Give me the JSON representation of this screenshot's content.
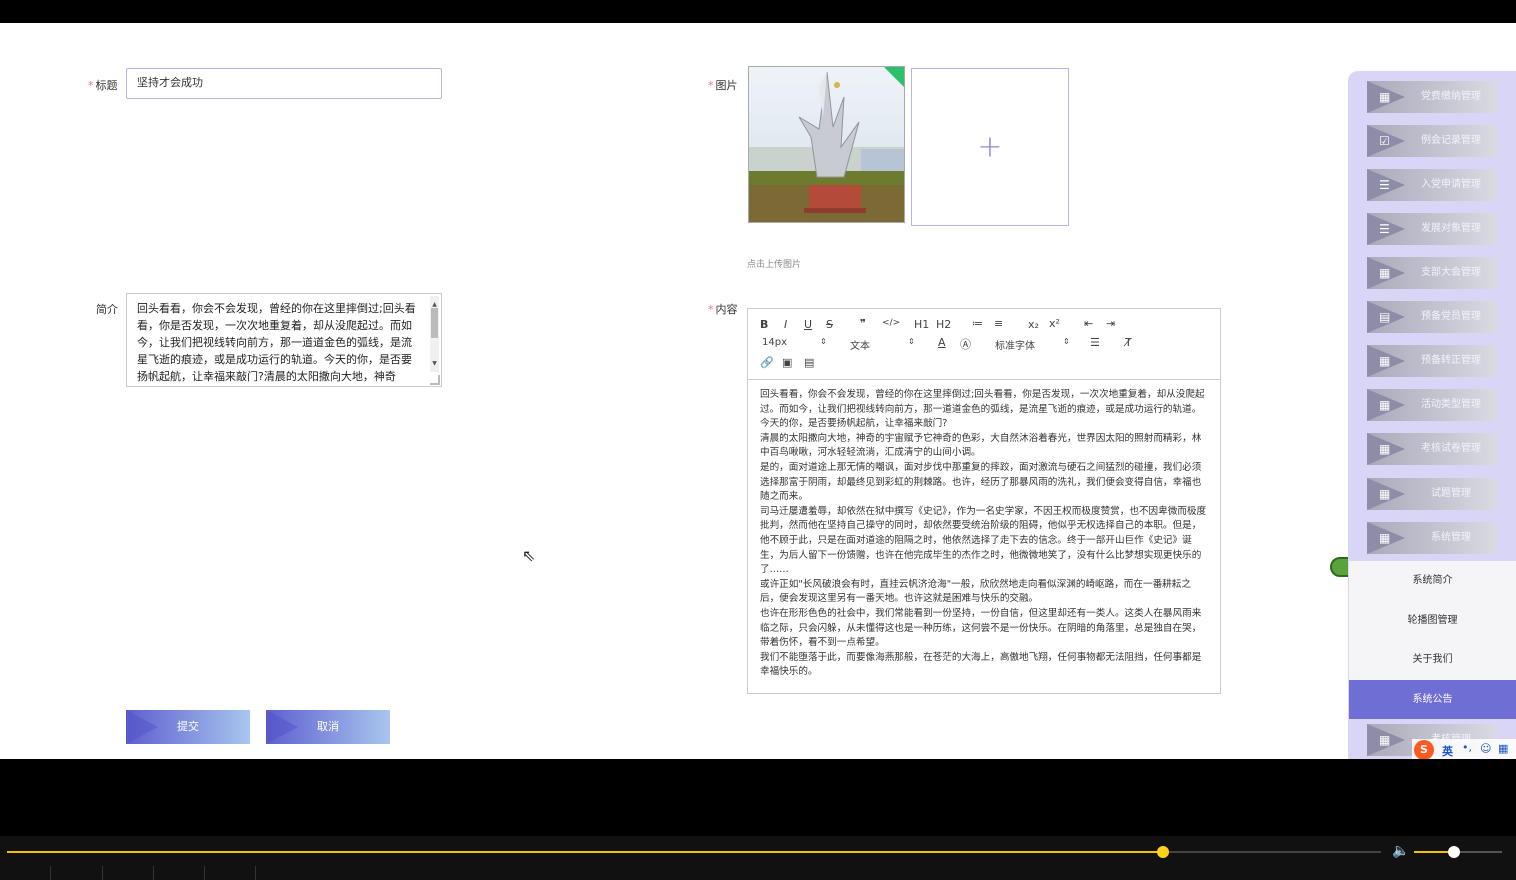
{
  "form": {
    "title_label": "标题",
    "title_value": "坚持才会成功",
    "image_label": "图片",
    "upload_hint": "点击上传图片",
    "intro_label": "简介",
    "intro_value": "回头看看，你会不会发现，曾经的你在这里摔倒过;回头看看，你是否发现，一次次地重复着，却从没爬起过。而如今，让我们把视线转向前方，那一道道金色的弧线，是流星飞逝的痕迹，或是成功运行的轨道。今天的你，是否要扬帆起航，让幸福来敲门?清晨的太阳撒向大地，神奇",
    "content_label": "内容",
    "required_mark": "*",
    "submit_label": "提交",
    "cancel_label": "取消"
  },
  "editor": {
    "toolbar_row1": [
      "B",
      "I",
      "U",
      "S",
      "❞",
      "</>",
      "H1",
      "H2",
      "≔",
      "≡",
      "x₂",
      "x²",
      "⇤",
      "⇥"
    ],
    "font_size": "14px",
    "paragraph": "文本",
    "font_family": "标准字体",
    "content": [
      "回头看看，你会不会发现，曾经的你在这里摔倒过;回头看看，你是否发现，一次次地重复着，却从没爬起过。而如今，让我们把视线转向前方，那一道道金色的弧线，是流星飞逝的痕迹，或是成功运行的轨道。今天的你，是否要扬帆起航，让幸福来敲门?",
      "清晨的太阳撒向大地，神奇的宇宙赋予它神奇的色彩，大自然沐浴着春光，世界因太阳的照射而精彩，林中百鸟啾啾，河水轻轻流淌，汇成清宁的山间小调。",
      "是的，面对道途上那无情的嘲讽，面对步伐中那重复的摔跤，面对激流与硬石之间猛烈的碰撞，我们必须选择那富于阴雨，却最终见到彩虹的荆棘路。也许，经历了那暴风雨的洗礼，我们便会变得自信，幸福也随之而来。",
      "司马迁屡遭羞辱，却依然在狱中撰写《史记》，作为一名史学家，不因王权而极度赞赏，也不因卑微而极度批判，然而他在坚持自己操守的同时，却依然要受统治阶级的阻碍，他似乎无权选择自己的本职。但是，他不顾于此，只是在面对道途的阻隔之时，他依然选择了走下去的信念。终于一部开山巨作《史记》诞生，为后人留下一份馈赠，也许在他完成毕生的杰作之时，他微微地笑了，没有什么比梦想实现更快乐的了……",
      "或许正如\"长风破浪会有时，直挂云帆济沧海\"一般，欣欣然地走向看似深渊的崎岖路，而在一番耕耘之后，便会发现这里另有一番天地。也许这就是困难与快乐的交融。",
      "也许在形形色色的社会中，我们常能看到一份坚持，一份自信，但这里却还有一类人。这类人在暴风雨来临之际，只会闪躲，从未懂得这也是一种历练，这何尝不是一份快乐。在阴暗的角落里，总是独自在哭，带着伤怀，看不到一点希望。",
      "我们不能堕落于此，而要像海燕那般，在苍茫的大海上，高傲地飞翔，任何事物都无法阻挡，任何事都是幸福快乐的。"
    ]
  },
  "sidebar": {
    "items": [
      {
        "label": "党费缴纳管理",
        "icon": "grid-icon"
      },
      {
        "label": "例会记录管理",
        "icon": "check-square-icon"
      },
      {
        "label": "入党申请管理",
        "icon": "list-icon"
      },
      {
        "label": "发展对象管理",
        "icon": "list-icon"
      },
      {
        "label": "支部大会管理",
        "icon": "grid-icon"
      },
      {
        "label": "预备党员管理",
        "icon": "clipboard-icon"
      },
      {
        "label": "预备转正管理",
        "icon": "grid-icon"
      },
      {
        "label": "活动类型管理",
        "icon": "grid-icon"
      },
      {
        "label": "考核试卷管理",
        "icon": "grid-icon"
      },
      {
        "label": "试题管理",
        "icon": "grid-icon"
      },
      {
        "label": "系统管理",
        "icon": "grid-icon"
      }
    ],
    "submenu": [
      "系统简介",
      "轮播图管理",
      "关于我们",
      "系统公告"
    ],
    "active_submenu": "系统公告",
    "last_item": "考核管理"
  },
  "ime": {
    "label": "英"
  },
  "video": {
    "progress": 0.841,
    "volume": 0.45
  },
  "colors": {
    "accent": "#6f6ed4",
    "sidebar_bg": "#d9d5f6",
    "required": "#f56c6c"
  }
}
